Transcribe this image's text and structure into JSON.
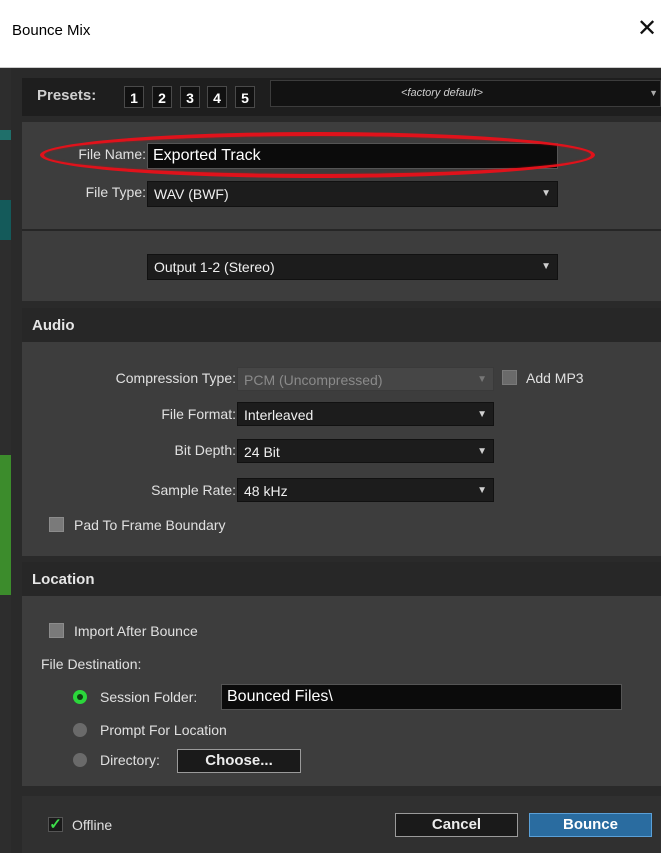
{
  "window": {
    "title": "Bounce Mix",
    "close_glyph": "✕"
  },
  "presets": {
    "label": "Presets:",
    "buttons": [
      "1",
      "2",
      "3",
      "4",
      "5"
    ],
    "selected": "<factory default>",
    "menu_arrow": "▼"
  },
  "file": {
    "name_label": "File Name:",
    "name_value": "Exported Track",
    "type_label": "File Type:",
    "type_value": "WAV (BWF)",
    "output_value": "Output 1-2 (Stereo)"
  },
  "audio": {
    "header": "Audio",
    "compression_label": "Compression Type:",
    "compression_value": "PCM (Uncompressed)",
    "add_mp3_label": "Add MP3",
    "format_label": "File Format:",
    "format_value": "Interleaved",
    "bit_depth_label": "Bit Depth:",
    "bit_depth_value": "24 Bit",
    "sample_rate_label": "Sample Rate:",
    "sample_rate_value": "48 kHz",
    "pad_label": "Pad To Frame Boundary"
  },
  "location": {
    "header": "Location",
    "import_label": "Import After Bounce",
    "destination_label": "File Destination:",
    "session_label": "Session Folder:",
    "session_value": "Bounced Files\\",
    "prompt_label": "Prompt For Location",
    "directory_label": "Directory:",
    "choose_label": "Choose..."
  },
  "footer": {
    "offline_label": "Offline",
    "offline_check": "✓",
    "cancel_label": "Cancel",
    "bounce_label": "Bounce"
  },
  "colors": {
    "accent_green": "#2bd63b",
    "primary_blue": "#2a6ca0",
    "annotation_red": "#e0121b"
  }
}
